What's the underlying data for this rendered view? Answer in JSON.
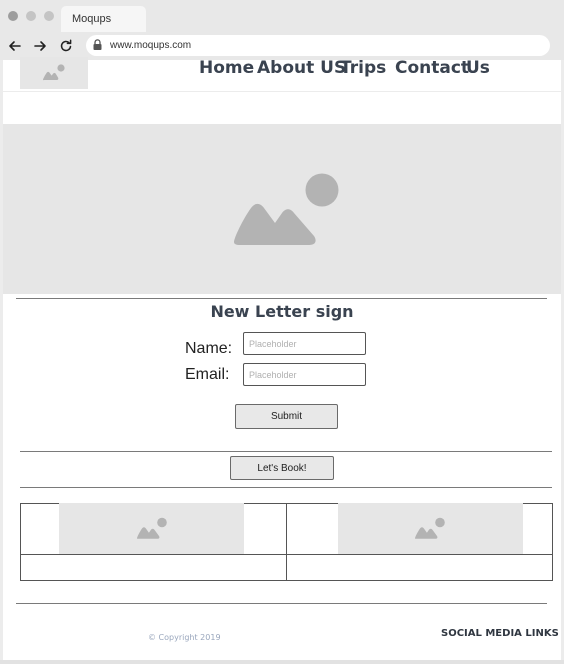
{
  "browser": {
    "tab_title": "Moqups",
    "url": "www.moqups.com",
    "colors": {
      "dot": "#c4c4c4",
      "chrome": "#e8e8e8"
    }
  },
  "header": {
    "logo_icon": "image-placeholder-icon",
    "nav": [
      "Home",
      "About US",
      "Trips",
      "Contact",
      "Us"
    ]
  },
  "hero": {
    "icon": "image-placeholder-icon"
  },
  "newsletter": {
    "title": "New Letter sign",
    "name_label": "Name:",
    "email_label": "Email:",
    "name_placeholder": "Placeholder",
    "email_placeholder": "Placeholder",
    "submit_label": "Submit"
  },
  "book_label": "Let's Book!",
  "cards": [
    {
      "icon": "image-placeholder-icon"
    },
    {
      "icon": "image-placeholder-icon"
    }
  ],
  "footer": {
    "copyright": "© Copyright 2019",
    "social": "SOCIAL MEDIA LINKS"
  },
  "colors": {
    "placeholder_fill": "#e6e6e6",
    "placeholder_icon": "#b3b3b3",
    "heading": "#3a4350"
  }
}
